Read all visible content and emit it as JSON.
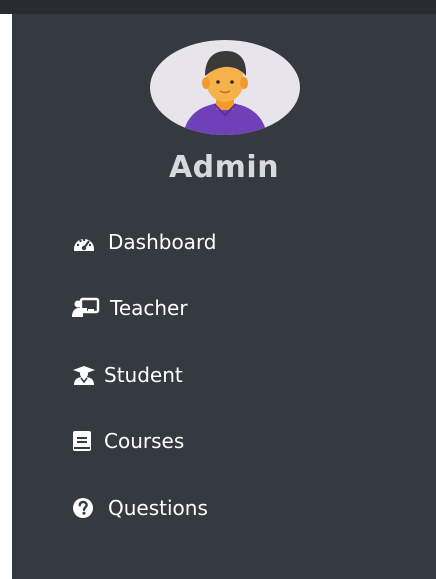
{
  "sidebar": {
    "user": {
      "name": "Admin",
      "avatar_icon": "user-avatar-icon"
    },
    "items": [
      {
        "label": "Dashboard",
        "icon": "speedometer-icon"
      },
      {
        "label": "Teacher",
        "icon": "chalkboard-teacher-icon"
      },
      {
        "label": "Student",
        "icon": "student-icon"
      },
      {
        "label": "Courses",
        "icon": "book-icon"
      },
      {
        "label": "Questions",
        "icon": "question-circle-icon"
      }
    ]
  },
  "colors": {
    "sidebar_bg": "#343a40",
    "topbar_bg": "#2a2b30",
    "avatar_bg": "#e8e4ec",
    "avatar_shirt": "#7040b8",
    "avatar_skin": "#f6b24a",
    "avatar_hair": "#3a3a3a"
  }
}
